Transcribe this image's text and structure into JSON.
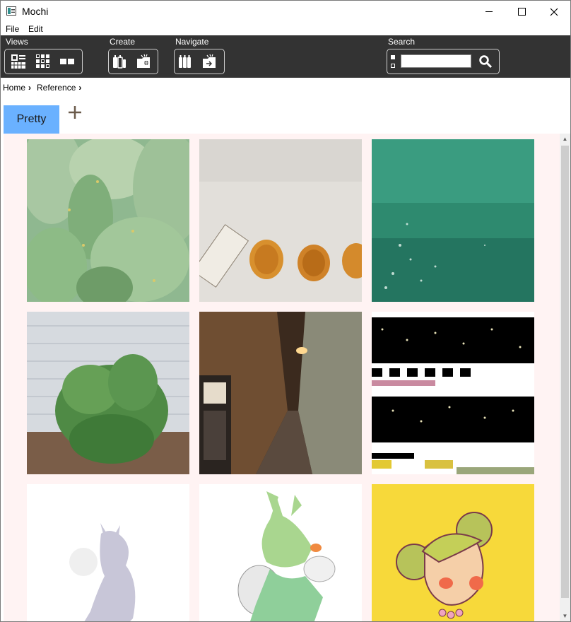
{
  "window": {
    "title": "Mochi"
  },
  "menu": {
    "file": "File",
    "edit": "Edit"
  },
  "toolbar": {
    "views_label": "Views",
    "create_label": "Create",
    "navigate_label": "Navigate",
    "search_label": "Search",
    "search_value": ""
  },
  "breadcrumb": {
    "items": [
      "Home",
      "Reference"
    ]
  },
  "tabs": {
    "active": "Pretty"
  },
  "gallery": {
    "items": [
      {
        "subject": "cactus"
      },
      {
        "subject": "dried-fruit-wall"
      },
      {
        "subject": "sea-water"
      },
      {
        "subject": "green-plant"
      },
      {
        "subject": "narrow-alley"
      },
      {
        "subject": "glitched-screenshot"
      },
      {
        "subject": "horned-figure-sketch"
      },
      {
        "subject": "green-creature-sketch"
      },
      {
        "subject": "cactus-girl-illustration"
      }
    ]
  },
  "colors": {
    "toolbar_bg": "#333333",
    "active_tab": "#6ab1ff",
    "content_bg": "#fff3f3"
  }
}
